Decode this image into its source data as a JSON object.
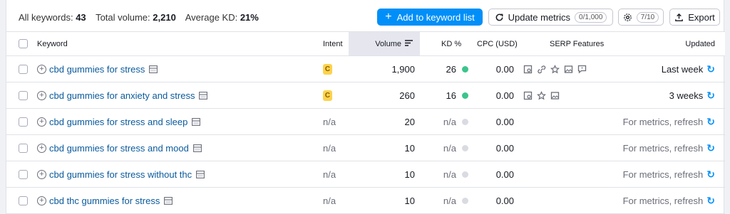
{
  "toolbar": {
    "all_keywords_label": "All keywords:",
    "all_keywords_value": "43",
    "total_volume_label": "Total volume:",
    "total_volume_value": "2,210",
    "average_kd_label": "Average KD:",
    "average_kd_value": "21%",
    "add_button": "Add to keyword list",
    "update_button": "Update metrics",
    "update_pill": "0/1,000",
    "settings_pill": "7/10",
    "export_button": "Export"
  },
  "headers": {
    "keyword": "Keyword",
    "intent": "Intent",
    "volume": "Volume",
    "kd": "KD %",
    "cpc": "CPC (USD)",
    "serp": "SERP Features",
    "updated": "Updated"
  },
  "colors": {
    "accent": "#008ff8",
    "kd_green": "#3cc48b",
    "kd_gray": "#dadbe2",
    "intent_commercial": "#fcd34d"
  },
  "rows": [
    {
      "keyword": "cbd gummies for stress",
      "intent": "C",
      "volume": "1,900",
      "kd": "26",
      "kd_color": "green",
      "cpc": "0.00",
      "serp": [
        "serp-snippet-icon",
        "link-icon",
        "star-icon",
        "image-icon",
        "comment-icon"
      ],
      "updated": "Last week"
    },
    {
      "keyword": "cbd gummies for anxiety and stress",
      "intent": "C",
      "volume": "260",
      "kd": "16",
      "kd_color": "green",
      "cpc": "0.00",
      "serp": [
        "serp-snippet-icon",
        "star-icon",
        "image-icon"
      ],
      "updated": "3 weeks"
    },
    {
      "keyword": "cbd gummies for stress and sleep",
      "intent": "n/a",
      "volume": "20",
      "kd": "n/a",
      "kd_color": "gray",
      "cpc": "0.00",
      "serp": [],
      "updated": "For metrics, refresh"
    },
    {
      "keyword": "cbd gummies for stress and mood",
      "intent": "n/a",
      "volume": "10",
      "kd": "n/a",
      "kd_color": "gray",
      "cpc": "0.00",
      "serp": [],
      "updated": "For metrics, refresh"
    },
    {
      "keyword": "cbd gummies for stress without thc",
      "intent": "n/a",
      "volume": "10",
      "kd": "n/a",
      "kd_color": "gray",
      "cpc": "0.00",
      "serp": [],
      "updated": "For metrics, refresh"
    },
    {
      "keyword": "cbd thc gummies for stress",
      "intent": "n/a",
      "volume": "10",
      "kd": "n/a",
      "kd_color": "gray",
      "cpc": "0.00",
      "serp": [],
      "updated": "For metrics, refresh"
    }
  ]
}
